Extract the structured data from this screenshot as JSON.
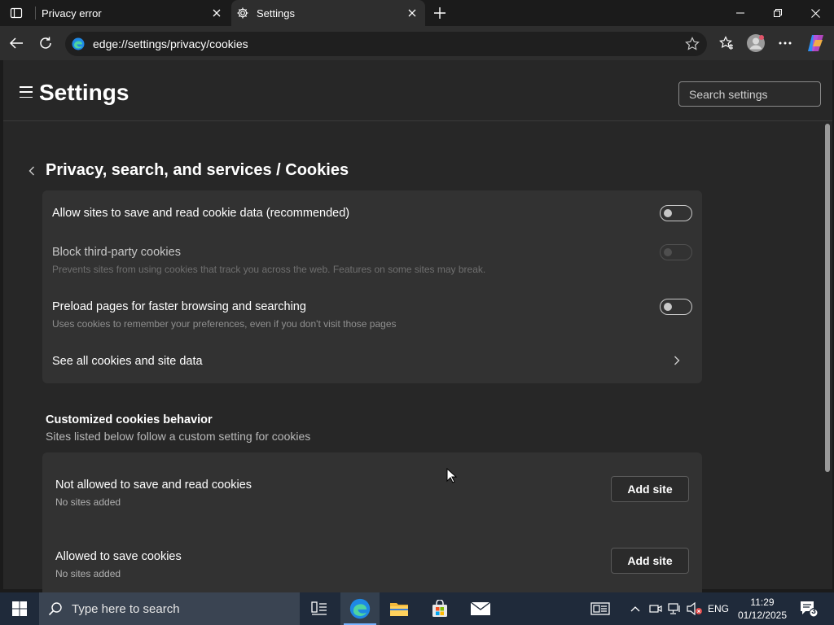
{
  "tabs": [
    {
      "title": "Privacy error"
    },
    {
      "title": "Settings"
    }
  ],
  "address": {
    "url": "edge://settings/privacy/cookies"
  },
  "header": {
    "title": "Settings",
    "search_placeholder": "Search settings"
  },
  "breadcrumb": {
    "text": "Privacy, search, and services / Cookies"
  },
  "cookie_settings": [
    {
      "label": "Allow sites to save and read cookie data (recommended)",
      "sub": "",
      "toggle": "off"
    },
    {
      "label": "Block third-party cookies",
      "sub": "Prevents sites from using cookies that track you across the web. Features on some sites may break.",
      "toggle": "off-disabled"
    },
    {
      "label": "Preload pages for faster browsing and searching",
      "sub": "Uses cookies to remember your preferences, even if you don't visit those pages",
      "toggle": "off"
    },
    {
      "label": "See all cookies and site data"
    }
  ],
  "custom_section": {
    "title": "Customized cookies behavior",
    "subtitle": "Sites listed below follow a custom setting for cookies",
    "lists": [
      {
        "label": "Not allowed to save and read cookies",
        "sub": "No sites added",
        "button": "Add site"
      },
      {
        "label": "Allowed to save cookies",
        "sub": "No sites added",
        "button": "Add site"
      }
    ]
  },
  "taskbar": {
    "search_placeholder": "Type here to search",
    "language": "ENG",
    "time": "11:29",
    "date": "01/12/2025",
    "notification_count": "3"
  },
  "colors": {
    "accent": "#78b4ff",
    "page_bg": "#272727",
    "card_bg": "#323232"
  }
}
